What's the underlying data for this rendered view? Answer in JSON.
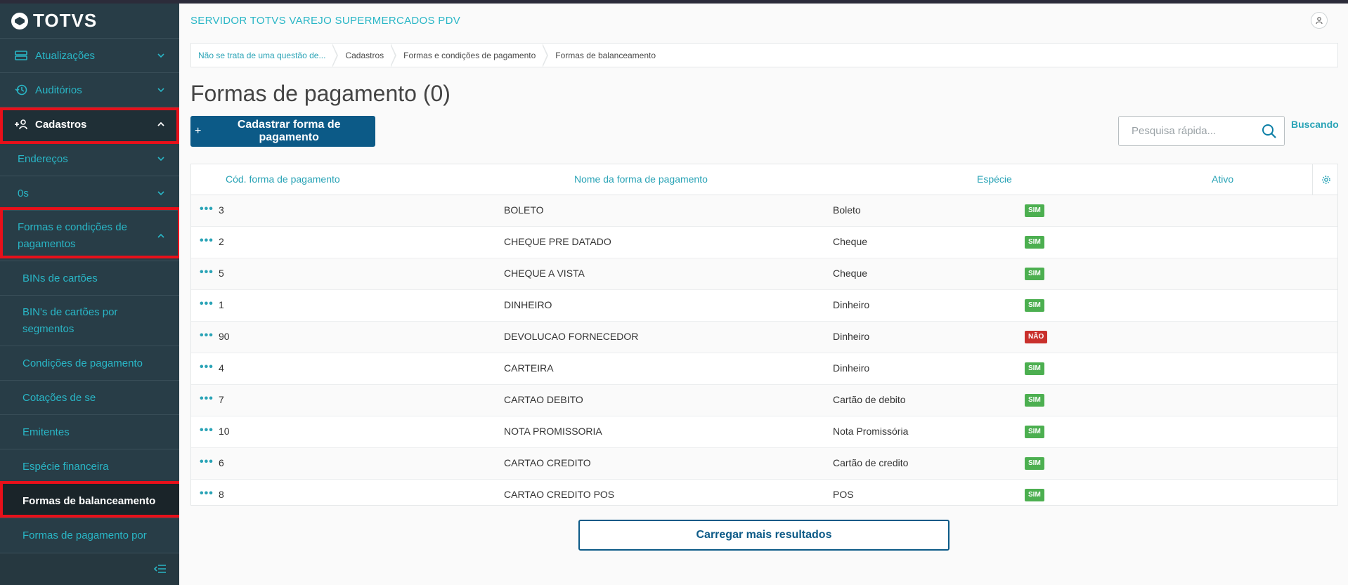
{
  "app": {
    "logo_text": "TOTVS"
  },
  "sidebar": {
    "items": [
      {
        "label": "Atualizações",
        "icon": "server-icon"
      },
      {
        "label": "Auditórios",
        "icon": "history-icon"
      },
      {
        "label": "Cadastros",
        "icon": "add-user-icon"
      },
      {
        "label": "Endereços"
      },
      {
        "label": "0s"
      },
      {
        "label": "Formas e condições de pagamentos"
      },
      {
        "label": "BINs de cartões"
      },
      {
        "label": "BIN's de cartões por segmentos"
      },
      {
        "label": "Condições de pagamento"
      },
      {
        "label": "Cotações de se"
      },
      {
        "label": "Emitentes"
      },
      {
        "label": "Espécie financeira"
      },
      {
        "label": "Formas de balanceamento"
      },
      {
        "label": "Formas de pagamento por"
      }
    ],
    "colors": {
      "background": "#283d47",
      "link": "#29b6c6",
      "highlight": "#e8101a"
    }
  },
  "header": {
    "server_title": "SERVIDOR TOTVS VAREJO SUPERMERCADOS PDV"
  },
  "breadcrumb": [
    "Não se trata de uma questão de...",
    "Cadastros",
    "Formas e condições de pagamento",
    "Formas de balanceamento"
  ],
  "page": {
    "title": "Formas de pagamento (0)",
    "add_button": "Cadastrar forma de pagamento",
    "add_button_prefix": "+",
    "search_placeholder": "Pesquisa rápida...",
    "busy_label": "Buscando",
    "load_more": "Carregar mais resultados"
  },
  "table": {
    "columns": [
      "Cód. forma de pagamento",
      "Nome da forma de pagamento",
      "Espécie",
      "Ativo"
    ],
    "actions_label": "•••",
    "rows": [
      {
        "code": "3",
        "name": "BOLETO",
        "species": "Boleto",
        "active": "SIM"
      },
      {
        "code": "2",
        "name": "CHEQUE PRE DATADO",
        "species": "Cheque",
        "active": "SIM"
      },
      {
        "code": "5",
        "name": "CHEQUE A VISTA",
        "species": "Cheque",
        "active": "SIM"
      },
      {
        "code": "1",
        "name": "DINHEIRO",
        "species": "Dinheiro",
        "active": "SIM"
      },
      {
        "code": "90",
        "name": "DEVOLUCAO FORNECEDOR",
        "species": "Dinheiro",
        "active": "NÃO"
      },
      {
        "code": "4",
        "name": "CARTEIRA",
        "species": "Dinheiro",
        "active": "SIM"
      },
      {
        "code": "7",
        "name": "CARTAO DEBITO",
        "species": "Cartão de debito",
        "active": "SIM"
      },
      {
        "code": "10",
        "name": "NOTA PROMISSORIA",
        "species": "Nota Promissória",
        "active": "SIM"
      },
      {
        "code": "6",
        "name": "CARTAO CREDITO",
        "species": "Cartão de credito",
        "active": "SIM"
      },
      {
        "code": "8",
        "name": "CARTAO CREDITO POS",
        "species": "POS",
        "active": "SIM"
      }
    ],
    "colors": {
      "yes": "#4caf50",
      "no": "#c9302c",
      "header": "#29a3b6"
    }
  }
}
